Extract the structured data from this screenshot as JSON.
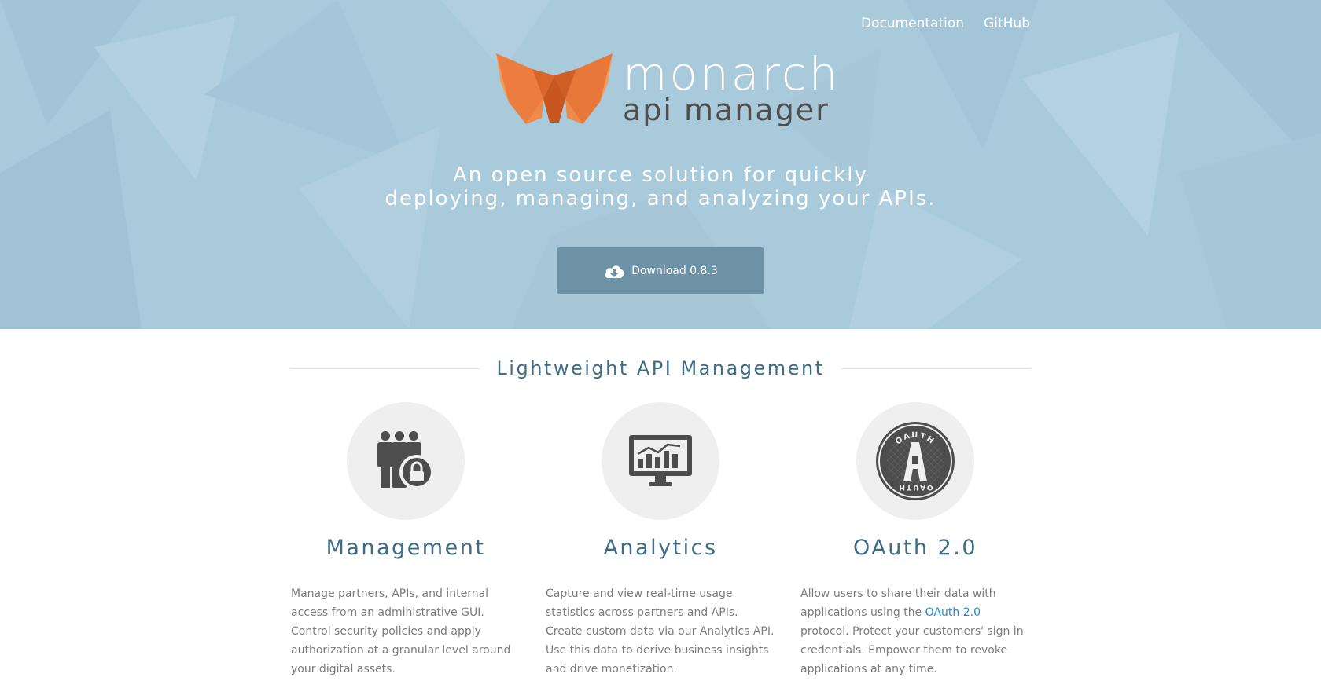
{
  "nav": {
    "documentation": "Documentation",
    "github": "GitHub"
  },
  "logo": {
    "word": "monarch",
    "sub": "api manager"
  },
  "hero": {
    "tagline_line1": "An open source solution for quickly",
    "tagline_line2": "deploying, managing, and analyzing your APIs.",
    "download_label": "Download 0.8.3"
  },
  "section": {
    "title": "Lightweight API Management"
  },
  "features": [
    {
      "icon": "users-lock-icon",
      "title": "Management",
      "desc": "Manage partners, APIs, and internal access from an administrative GUI. Control security policies and apply authorization at a granular level around your digital assets."
    },
    {
      "icon": "monitor-chart-icon",
      "title": "Analytics",
      "desc": "Capture and view real-time usage statistics across partners and APIs. Create custom data via our Analytics API. Use this data to derive business insights and drive monetization."
    },
    {
      "icon": "oauth-badge-icon",
      "title": "OAuth 2.0",
      "desc_before": "Allow users to share their data with applications using the ",
      "desc_link": "OAuth 2.0",
      "desc_after": " protocol. Protect your customers' sign in credentials. Empower them to revoke applications at any time.",
      "badge_text": "OAUTH"
    }
  ],
  "colors": {
    "hero_bg": "#a9cadb",
    "button_bg": "#6d92a5",
    "heading": "#3f6c86",
    "link": "#2a86c6",
    "butterfly": "#e8773a"
  }
}
